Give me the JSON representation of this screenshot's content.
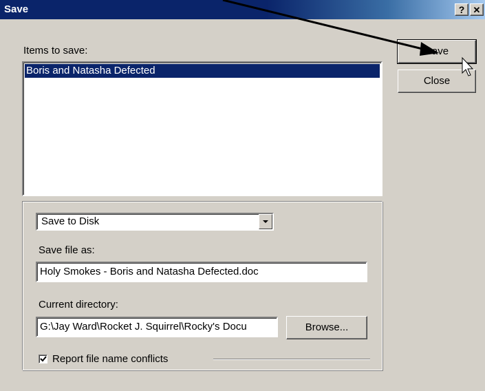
{
  "window": {
    "title": "Save",
    "help_label": "?",
    "close_label": "✕"
  },
  "items_label": "Items to save:",
  "items": [
    {
      "label": "Boris and Natasha Defected",
      "selected": true
    }
  ],
  "buttons": {
    "save_label": "Save",
    "close_label": "Close",
    "browse_label": "Browse..."
  },
  "destination": {
    "selected": "Save to Disk"
  },
  "save_file_as": {
    "label": "Save file as:",
    "value": "Holy Smokes - Boris and Natasha Defected.doc"
  },
  "current_directory": {
    "label": "Current directory:",
    "value": "G:\\Jay Ward\\Rocket J. Squirrel\\Rocky's Docu"
  },
  "report_conflicts": {
    "label": "Report file name conflicts",
    "checked": true
  },
  "colors": {
    "titlebar": "#0a246a",
    "selection": "#0a246a",
    "face": "#d4d0c8"
  }
}
